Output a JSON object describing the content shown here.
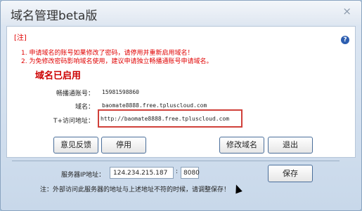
{
  "window": {
    "title": "域名管理beta版",
    "close_glyph": "×"
  },
  "notice": {
    "label": "[注]",
    "help_glyph": "?",
    "items": [
      "1. 申请域名的账号如果修改了密码，请停用并重新启用域名！",
      "2. 为免修改密码影响域名使用，建议申请独立畅播通账号申请域名。"
    ]
  },
  "status": {
    "text": "域名已启用"
  },
  "fields": {
    "account_label": "畅播通账号：",
    "account_value": "15981598860",
    "domain_label": "域名：",
    "domain_value": "baomate8888.free.tpluscloud.com",
    "url_label": "T+访问地址：",
    "url_value": "http://baomate8888.free.tpluscloud.com"
  },
  "buttons": {
    "feedback": "意见反馈",
    "disable": "停用",
    "modify": "修改域名",
    "exit": "退出",
    "save": "保存"
  },
  "server": {
    "ip_label": "服务器IP地址：",
    "ip_value": "124.234.215.187",
    "port_sep": ":",
    "port_value": "8080",
    "note": "注：外部访问此服务器的地址与上述地址不符的时候，请调整保存！"
  },
  "colors": {
    "accent": "#c00000",
    "button_border": "#4a6e9a",
    "highlight_box": "#d0403a"
  }
}
